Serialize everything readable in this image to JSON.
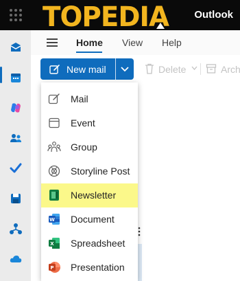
{
  "titlebar": {
    "brand_logo": "TOPEDIA",
    "app_name": "Outlook"
  },
  "rail": {
    "icons": [
      "mail-icon",
      "calendar-icon",
      "copilot-icon",
      "people-icon",
      "todo-icon",
      "save-icon",
      "org-explorer-icon",
      "onedrive-icon"
    ]
  },
  "tabs": [
    "Home",
    "View",
    "Help"
  ],
  "ribbon": {
    "new_mail": "New mail",
    "delete": "Delete",
    "archive": "Arch"
  },
  "menu": {
    "items": [
      {
        "label": "Mail",
        "icon": "compose-icon"
      },
      {
        "label": "Event",
        "icon": "calendar-icon"
      },
      {
        "label": "Group",
        "icon": "group-icon"
      },
      {
        "label": "Storyline Post",
        "icon": "storyline-icon"
      },
      {
        "label": "Newsletter",
        "icon": "newsletter-icon",
        "highlighted": true
      },
      {
        "label": "Document",
        "icon": "word-icon"
      },
      {
        "label": "Spreadsheet",
        "icon": "excel-icon"
      },
      {
        "label": "Presentation",
        "icon": "powerpoint-icon"
      }
    ]
  },
  "colors": {
    "accent": "#0f6cbd",
    "logo": "#f2b51f",
    "highlight": "#fbf88a",
    "titlebar": "#0a0a0a"
  }
}
